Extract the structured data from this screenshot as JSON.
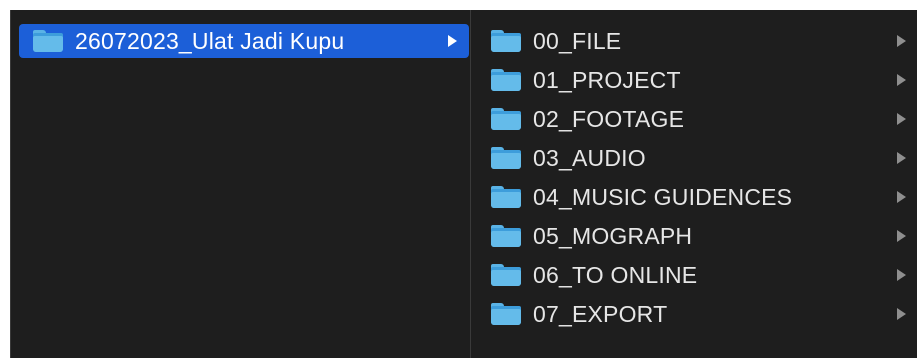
{
  "colors": {
    "window_background": "#1e1e1e",
    "selection": "#1c5fd8",
    "folder": "#5ab3e6",
    "text": "#e6e6e6",
    "chevron": "#8f8f8f"
  },
  "column1": {
    "items": [
      {
        "label": "26072023_Ulat Jadi Kupu",
        "icon": "folder-icon",
        "selected": true,
        "has_children": true
      }
    ]
  },
  "column2": {
    "items": [
      {
        "label": "00_FILE",
        "icon": "folder-icon",
        "has_children": true
      },
      {
        "label": "01_PROJECT",
        "icon": "folder-icon",
        "has_children": true
      },
      {
        "label": "02_FOOTAGE",
        "icon": "folder-icon",
        "has_children": true
      },
      {
        "label": "03_AUDIO",
        "icon": "folder-icon",
        "has_children": true
      },
      {
        "label": "04_MUSIC GUIDENCES",
        "icon": "folder-icon",
        "has_children": true
      },
      {
        "label": "05_MOGRAPH",
        "icon": "folder-icon",
        "has_children": true
      },
      {
        "label": "06_TO ONLINE",
        "icon": "folder-icon",
        "has_children": true
      },
      {
        "label": "07_EXPORT",
        "icon": "folder-icon",
        "has_children": true
      }
    ]
  }
}
